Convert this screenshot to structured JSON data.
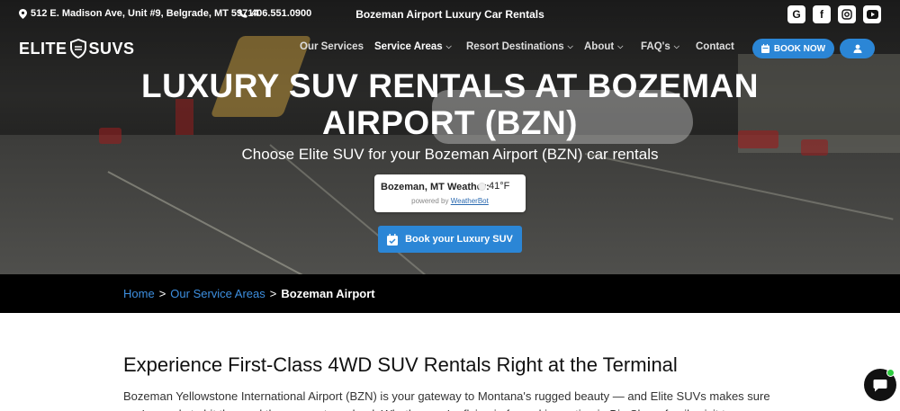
{
  "topbar": {
    "address": "512 E. Madison Ave, Unit #9, Belgrade, MT 59714",
    "phone": "406.551.0900",
    "center_title": "Bozeman Airport Luxury Car Rentals",
    "social": [
      "google-icon",
      "facebook-icon",
      "instagram-icon",
      "youtube-icon"
    ]
  },
  "logo": {
    "left": "ELITE",
    "right": "SUVS"
  },
  "nav": {
    "items": [
      {
        "label": "Our Services",
        "dropdown": false
      },
      {
        "label": "Service Areas",
        "dropdown": true
      },
      {
        "label": "Resort Destinations",
        "dropdown": true
      },
      {
        "label": "About",
        "dropdown": true
      },
      {
        "label": "FAQ's",
        "dropdown": true
      },
      {
        "label": "Contact",
        "dropdown": false
      }
    ],
    "book_now": "BOOK NOW"
  },
  "hero": {
    "title_line1": "LUXURY SUV RENTALS AT BOZEMAN",
    "title_line2": "AIRPORT (BZN)",
    "subtitle": "Choose Elite SUV for your Bozeman Airport (BZN) car rentals",
    "weather": {
      "label": "Bozeman, MT Weather:",
      "temp": "41°F",
      "powered_prefix": "powered by",
      "powered_link": "WeatherBot"
    },
    "cta": "Book your Luxury SUV"
  },
  "breadcrumb": {
    "home": "Home",
    "area": "Our Service Areas",
    "current": "Bozeman Airport",
    "sep": ">"
  },
  "content": {
    "heading": "Experience First-Class 4WD SUV Rentals Right at the Terminal",
    "paragraph": "Bozeman Yellowstone International Airport (BZN) is your gateway to Montana's rugged beauty — and Elite SUVs makes sure you're ready to hit the road the moment you land. Whether you're flying in for a ski vacation in Big Sky, a family visit to"
  },
  "colors": {
    "accent": "#2b86d6",
    "link": "#3d8fe0",
    "breadcrumb_bg": "#000000"
  }
}
